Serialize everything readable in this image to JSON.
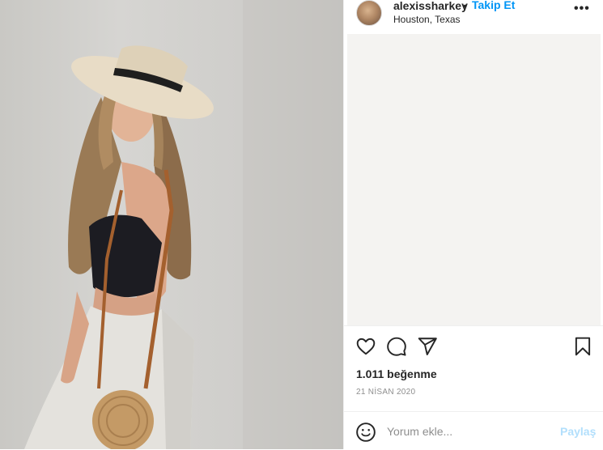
{
  "post": {
    "username": "alexissharkey",
    "separator": "•",
    "follow_label": "Takip Et",
    "location": "Houston, Texas",
    "more_label": "•••",
    "likes_text": "1.011 beğenme",
    "date_text": "21 NİSAN 2020"
  },
  "actions": {
    "icons": [
      "heart-icon",
      "comment-icon",
      "share-icon",
      "bookmark-icon"
    ]
  },
  "comment_box": {
    "placeholder": "Yorum ekle...",
    "value": "",
    "submit_label": "Paylaş"
  },
  "colors": {
    "accent": "#0095f6",
    "submit_disabled": "#b2dffc",
    "text": "#262626",
    "muted": "#8e8e8e"
  }
}
